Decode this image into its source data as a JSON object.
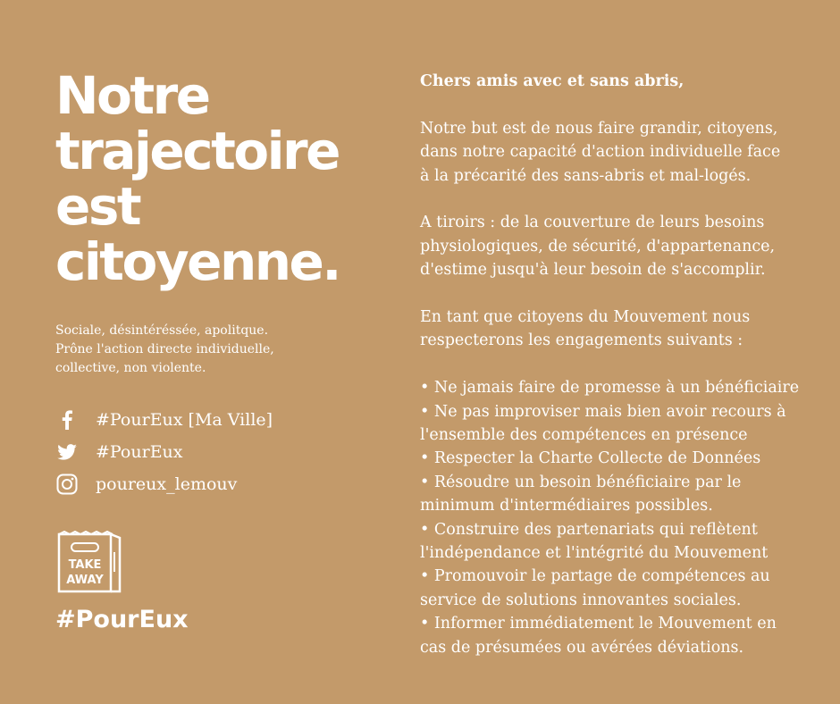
{
  "headline": [
    "Notre",
    "trajectoire",
    "est",
    "citoyenne."
  ],
  "tagline": [
    "Sociale, désintéréssée, apolitque.",
    "Prône l'action directe individuelle,",
    "collective, non violente."
  ],
  "social": [
    {
      "icon": "facebook-icon",
      "text": "#PourEux [Ma Ville]"
    },
    {
      "icon": "twitter-icon",
      "text": "#PourEux"
    },
    {
      "icon": "instagram-icon",
      "text": "poureux_lemouv"
    }
  ],
  "logo": {
    "line1": "TAKE",
    "line2": "AWAY"
  },
  "hashtag": "#PourEux",
  "letter": {
    "greeting": "Chers amis avec et sans abris,",
    "paragraphs": [
      [
        "Notre but est de nous faire grandir, citoyens,",
        "dans notre capacité d'action individuelle face",
        "à la précarité des sans-abris et mal-logés."
      ],
      [
        "A tiroirs : de la couverture de leurs besoins",
        "physiologiques, de sécurité, d'appartenance,",
        "d'estime jusqu'à leur besoin de s'accomplir."
      ],
      [
        "En tant que citoyens du Mouvement nous",
        "respecterons les engagements suivants :"
      ],
      [
        "• Ne jamais faire de promesse à un bénéficiaire",
        "• Ne pas improviser mais bien avoir recours à",
        "l'ensemble des compétences en présence",
        "• Respecter la Charte Collecte de Données",
        "• Résoudre un besoin bénéficiaire par le",
        "minimum d'intermédiaires possibles.",
        "• Construire des partenariats qui reflètent",
        "l'indépendance et l'intégrité du Mouvement",
        "• Promouvoir le partage de compétences au",
        "service de solutions innovantes sociales.",
        "• Informer immédiatement le Mouvement en",
        "cas de présumées ou avérées déviations."
      ]
    ]
  }
}
